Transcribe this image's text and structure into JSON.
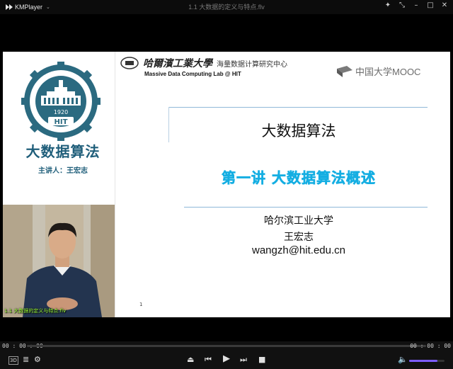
{
  "app": {
    "name": "KMPlayer",
    "file_title": "1.1 大数据的定义与特点.flv"
  },
  "window_controls": [
    "pin-icon",
    "restore-arrows-icon",
    "minimize-icon",
    "maximize-icon",
    "close-icon"
  ],
  "slide": {
    "course_title": "大数据算法",
    "teacher": "主讲人：王宏志",
    "logo_year": "1920",
    "logo_text": "HIT",
    "hit_name": "哈爾濱工業大學",
    "hit_center": "海量数据计算研究中心",
    "hit_lab": "Massive Data Computing Lab @ HIT",
    "mooc_label": "中国大学MOOC",
    "title": "大数据算法",
    "subtitle": "第一讲 大数据算法概述",
    "university": "哈尔滨工业大学",
    "lecturer": "王宏志",
    "email": "wangzh@hit.edu.cn",
    "page_number": "1",
    "video_caption": "1.1 大数据的定义与特点.flv"
  },
  "playback": {
    "elapsed": "00 : 00 : 00",
    "total": "00 : 00 : 00",
    "progress": 0,
    "volume": 0.8,
    "badge_3d": "3D"
  },
  "colors": {
    "accent": "#15aee2",
    "hit_teal": "#1f5e7a",
    "volume": "#7c5cff"
  }
}
